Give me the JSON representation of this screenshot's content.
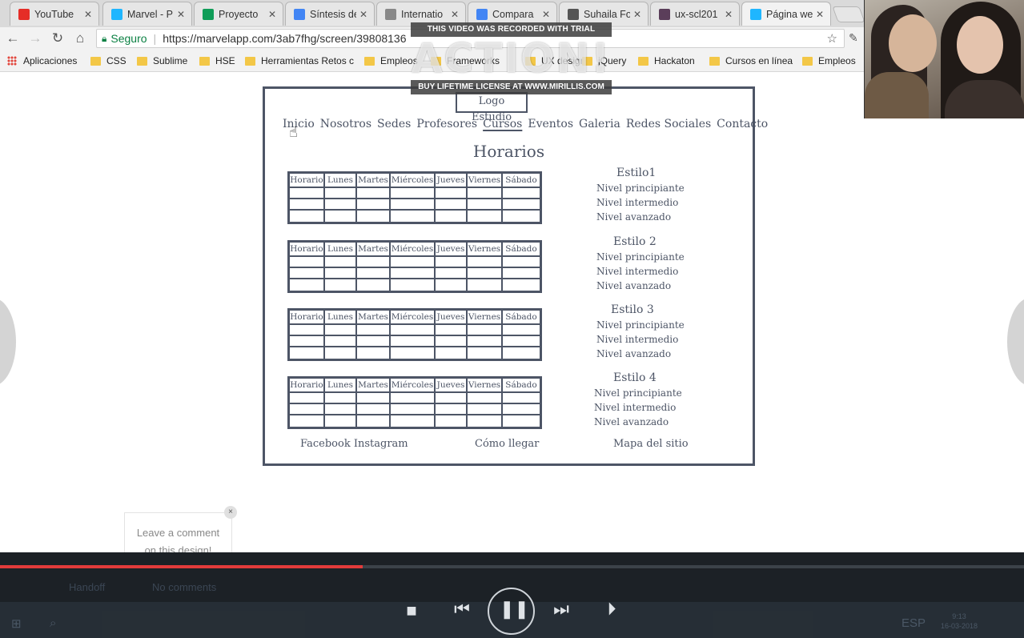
{
  "browser": {
    "tabs": [
      {
        "label": "YouTube",
        "icon": "youtube-icon",
        "icon_color": "#e52d27",
        "active": false
      },
      {
        "label": "Marvel - P",
        "icon": "marvel-icon",
        "icon_color": "#1fb6ff",
        "active": false
      },
      {
        "label": "Proyecto ",
        "icon": "drive-icon",
        "icon_color": "#0f9d58",
        "active": false
      },
      {
        "label": "Síntesis de",
        "icon": "docs-icon",
        "icon_color": "#4285f4",
        "active": false
      },
      {
        "label": "Internatio",
        "icon": "page-icon",
        "icon_color": "#888888",
        "active": false
      },
      {
        "label": "Compara",
        "icon": "docs-icon",
        "icon_color": "#4285f4",
        "active": false
      },
      {
        "label": "Suhaila Fo",
        "icon": "wave-icon",
        "icon_color": "#555555",
        "active": false
      },
      {
        "label": "ux-scl201",
        "icon": "slack-icon",
        "icon_color": "#5b3e5a",
        "active": false
      },
      {
        "label": "Página we",
        "icon": "marvel-icon",
        "icon_color": "#1fb6ff",
        "active": true
      }
    ],
    "secure_label": "Seguro",
    "url": "https://marvelapp.com/3ab7fhg/screen/39808136",
    "bookmarks": [
      {
        "label": "Aplicaciones",
        "type": "apps"
      },
      {
        "label": "CSS",
        "type": "folder"
      },
      {
        "label": "Sublime",
        "type": "folder"
      },
      {
        "label": "HSE",
        "type": "folder"
      },
      {
        "label": "Herramientas Retos c",
        "type": "folder"
      },
      {
        "label": "Empleos",
        "type": "folder"
      },
      {
        "label": "Frameworks",
        "type": "folder"
      },
      {
        "label": "UX design",
        "type": "folder"
      },
      {
        "label": "jQuery",
        "type": "folder"
      },
      {
        "label": "Hackaton",
        "type": "folder"
      },
      {
        "label": "Cursos en línea",
        "type": "folder"
      },
      {
        "label": "Empleos",
        "type": "folder"
      }
    ]
  },
  "watermark": {
    "top": "THIS VIDEO WAS RECORDED WITH TRIAL VERSION",
    "logo": "ACTION!",
    "bottom": "BUY LIFETIME LICENSE AT WWW.MIRILLIS.COM"
  },
  "mockup": {
    "logo": "Logo Estudio",
    "nav": [
      "Inicio",
      "Nosotros",
      "Sedes",
      "Profesores",
      "Cursos",
      "Eventos",
      "Galeria",
      "Redes Sociales",
      "Contacto"
    ],
    "nav_selected": "Cursos",
    "heading": "Horarios",
    "table_headers": [
      "Horario",
      "Lunes",
      "Martes",
      "Miércoles",
      "Jueves",
      "Viernes",
      "Sábado"
    ],
    "styles": [
      {
        "title": "Estilo1",
        "levels": [
          "Nivel principiante",
          "Nivel intermedio",
          "Nivel avanzado"
        ]
      },
      {
        "title": "Estilo 2",
        "levels": [
          "Nivel principiante",
          "Nivel intermedio",
          "Nivel avanzado"
        ]
      },
      {
        "title": "Estilo 3",
        "levels": [
          "Nivel principiante",
          "Nivel intermedio",
          "Nivel avanzado"
        ]
      },
      {
        "title": "Estilo 4",
        "levels": [
          "Nivel principiante",
          "Nivel intermedio",
          "Nivel avanzado"
        ]
      }
    ],
    "footer": {
      "social": "Facebook Instagram",
      "directions": "Cómo llegar",
      "sitemap": "Mapa del sitio"
    }
  },
  "comment": {
    "text_line1": "Leave a comment",
    "text_line2": "on this design!",
    "close": "×"
  },
  "player": {
    "progress": 0.354,
    "ghost_left": "Handoff",
    "ghost_right": "No comments",
    "progress_color": "#e23b3b",
    "clock_time": "9:13",
    "clock_date": "16-03-2018",
    "lang": "ESP"
  }
}
